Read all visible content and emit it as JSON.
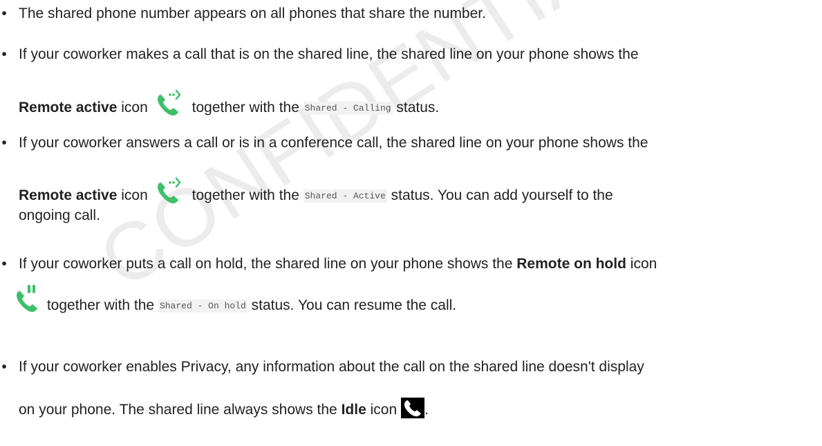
{
  "watermark": "CONFIDENTIAL DRAFT",
  "bullets": [
    {
      "text": "The shared phone number appears on all phones that share the number."
    },
    {
      "line1": "If your coworker makes a call that is on the shared line, the shared line on your phone shows the",
      "bold": "Remote active",
      "after_bold": "icon",
      "icon": "remote-active-icon",
      "together": "together with the",
      "status": "Shared - Calling",
      "end": "status."
    },
    {
      "line1": "If your coworker answers a call or is in a conference call, the shared line on your phone shows the",
      "bold": "Remote active",
      "after_bold": "icon",
      "icon": "remote-active-icon",
      "together": "together with the",
      "status": "Shared - Active",
      "end": "status. You can add yourself to the",
      "line3": "ongoing call."
    },
    {
      "line1_pre": "If your coworker puts a call on hold, the shared line on your phone shows the",
      "bold": "Remote on hold",
      "after_bold": "icon",
      "icon": "remote-on-hold-icon",
      "together": "together with the",
      "status": "Shared - On hold",
      "end": "status. You can resume the call."
    },
    {
      "line1": "If your coworker enables Privacy, any information about the call on the shared line doesn't display",
      "line2_pre": "on your phone. The shared line always shows the",
      "bold": "Idle",
      "after_bold": "icon",
      "icon": "idle-icon",
      "end": "."
    }
  ],
  "colors": {
    "accent_green": "#3dbf6c",
    "text": "#222222",
    "code_bg": "#f2f2f2"
  }
}
